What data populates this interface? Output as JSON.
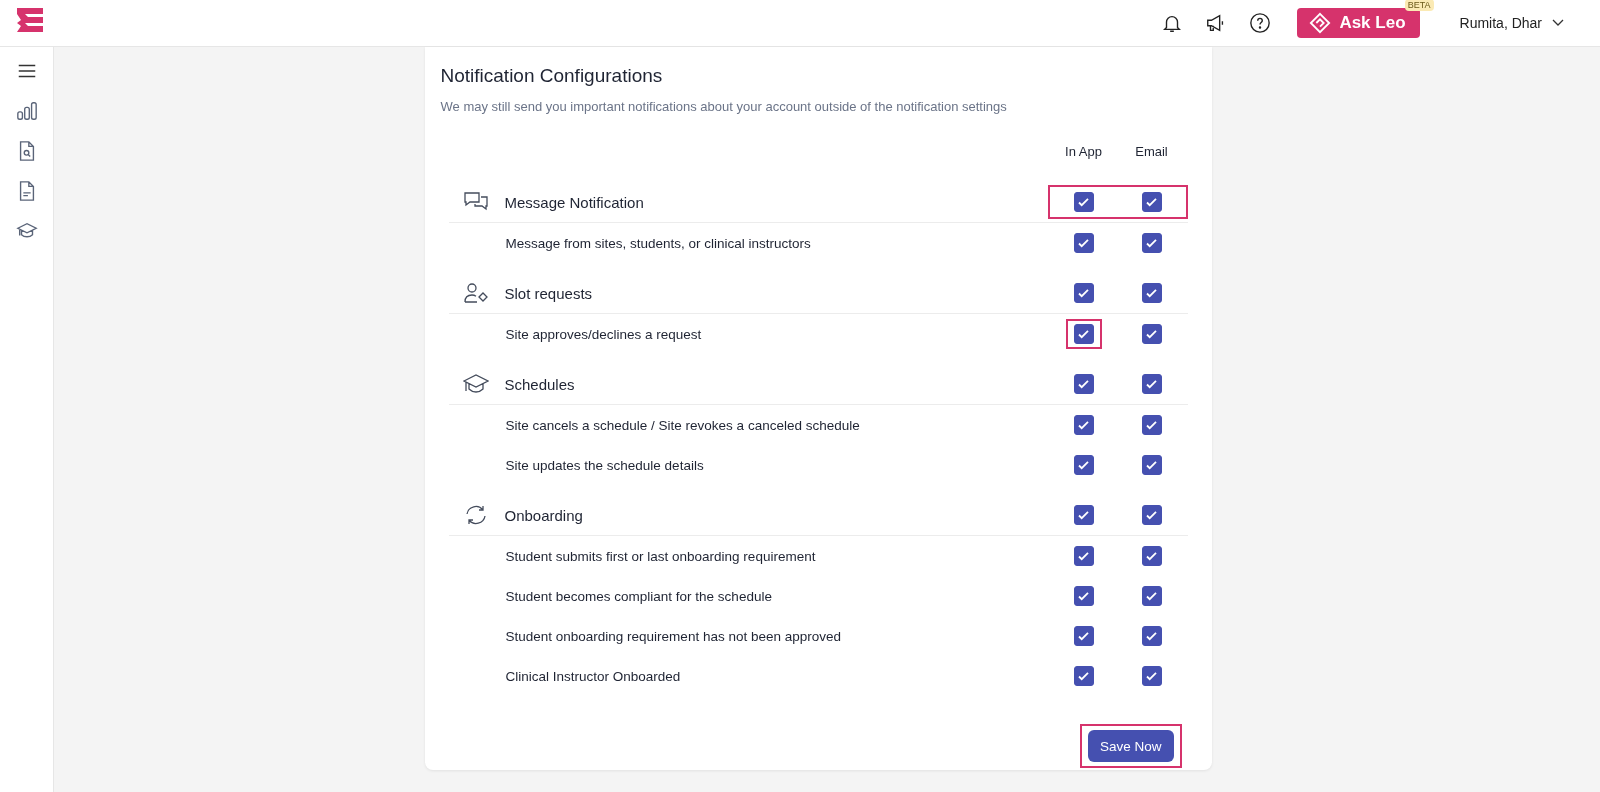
{
  "top_bar": {
    "ask_button": {
      "label": "Ask Leo",
      "badge": "BETA"
    },
    "user": {
      "name": "Rumita, Dhar"
    }
  },
  "card": {
    "title": "Notification Configurations",
    "subtitle": "We may still send you important notifications about your account outside of the notification settings",
    "columns": [
      "In App",
      "Email"
    ],
    "sections": [
      {
        "kind": "message",
        "title": "Message Notification",
        "in_app": true,
        "email": true,
        "highlighted": true,
        "items": [
          {
            "label": "Message from sites, students, or clinical instructors",
            "in_app": true,
            "email": true
          }
        ]
      },
      {
        "kind": "slot",
        "title": "Slot requests",
        "in_app": true,
        "email": true,
        "items": [
          {
            "label": "Site approves/declines a request",
            "in_app": true,
            "email": true,
            "in_app_highlighted": true
          }
        ]
      },
      {
        "kind": "schedule",
        "title": "Schedules",
        "in_app": true,
        "email": true,
        "items": [
          {
            "label": "Site cancels a schedule / Site revokes a canceled schedule",
            "in_app": true,
            "email": true
          },
          {
            "label": "Site updates the schedule details",
            "in_app": true,
            "email": true
          }
        ]
      },
      {
        "kind": "onboarding",
        "title": "Onboarding",
        "in_app": true,
        "email": true,
        "items": [
          {
            "label": "Student submits first or last onboarding requirement",
            "in_app": true,
            "email": true
          },
          {
            "label": "Student becomes compliant for the schedule",
            "in_app": true,
            "email": true
          },
          {
            "label": "Student onboarding requirement has not been approved",
            "in_app": true,
            "email": true
          },
          {
            "label": "Clinical Instructor Onboarded",
            "in_app": true,
            "email": true
          }
        ]
      }
    ],
    "save_button": {
      "label": "Save Now",
      "highlighted": true
    }
  }
}
